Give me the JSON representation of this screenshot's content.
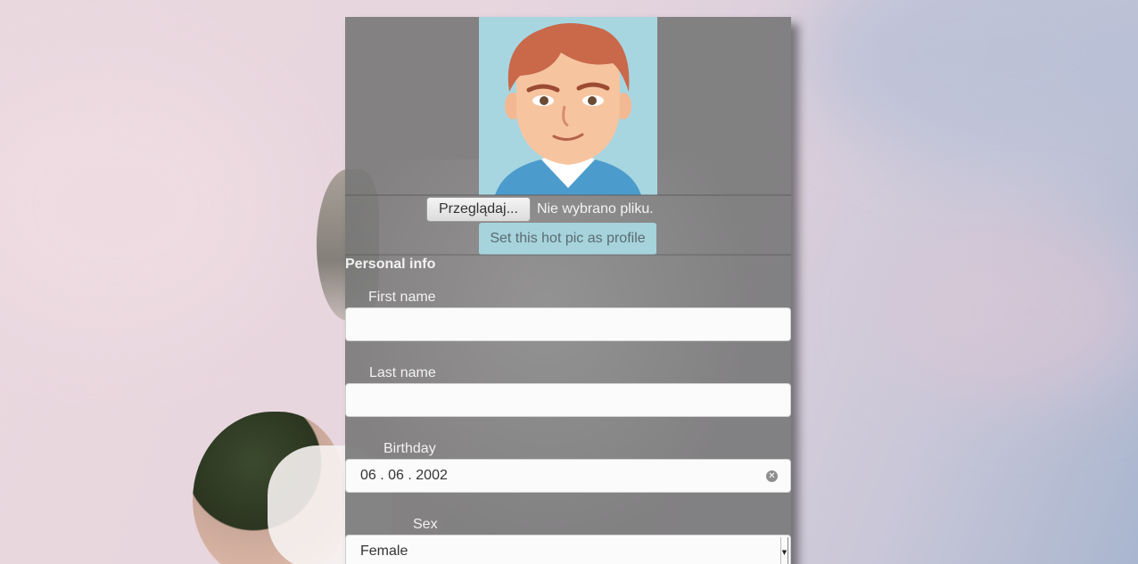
{
  "profile": {
    "avatar_icon": "cartoon-man-avatar-icon",
    "file_button_label": "Przeglądaj...",
    "file_status": "Nie wybrano pliku.",
    "set_profile_label": "Set this hot pic as profile"
  },
  "personal_info": {
    "title": "Personal info",
    "first_name_label": "First name",
    "first_name_value": "",
    "last_name_label": "Last name",
    "last_name_value": "",
    "birthday_label": "Birthday",
    "birthday_value": "06 . 06 . 2002",
    "sex_label": "Sex",
    "sex_value": "Female"
  },
  "colors": {
    "panel": "#787878",
    "button_accent": "#a6d3dc"
  }
}
